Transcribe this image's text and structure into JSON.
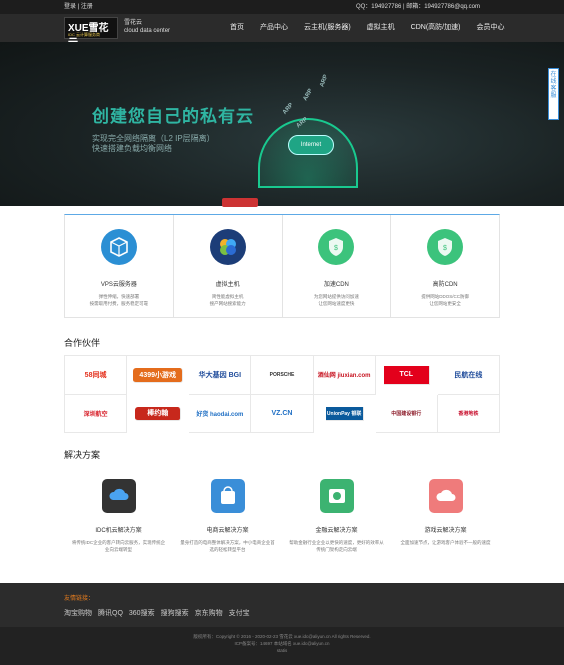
{
  "topbar": {
    "login": "登录",
    "sep": "|",
    "register": "注册",
    "contact": "QQ：194927786 | 邮箱：194927786@qq.com"
  },
  "logo": {
    "main": "XUE雪花云",
    "sub": "IDC 云计算服务商"
  },
  "brand": {
    "cn": "雪花云",
    "en": "cloud data center"
  },
  "nav": [
    "首页",
    "产品中心",
    "云主机(服务器)",
    "虚拟主机",
    "CDN(高防/加速)",
    "会员中心"
  ],
  "hero": {
    "title": "创建您自己的私有云",
    "line1": "实现完全网络隔离（L2 IP层隔离）",
    "line2": "快速搭建负载均衡网络",
    "badge": "Internet",
    "arp": "ARP"
  },
  "float": "在线客服",
  "services": [
    {
      "title": "VPS云服务器",
      "desc1": "弹性伸缩，快速部署",
      "desc2": "按需取用付费，服务稳定可靠"
    },
    {
      "title": "虚拟主机",
      "desc1": "简性能虚拟主机",
      "desc2": "搜产网站搜索能力"
    },
    {
      "title": "加速CDN",
      "desc1": "为您网站提供访问加速",
      "desc2": "让您网站速度更快"
    },
    {
      "title": "高防CDN",
      "desc1": "提供网站DDOS/CC防御",
      "desc2": "让您网站更安全"
    }
  ],
  "partners_title": "合作伙伴",
  "partners": [
    "58同城",
    "4399小游戏",
    "华大基因 BGI",
    "PORSCHE",
    "酒仙网 jiuxian.com",
    "TCL",
    "民航在线",
    "深圳航空",
    "棒约翰",
    "好货 haodai.com",
    "VZ.CN",
    "UnionPay 银联",
    "中国建设银行",
    "香港地铁"
  ],
  "solutions_title": "解决方案",
  "solutions": [
    {
      "title": "IDC机云解决方案",
      "desc": "将传统IDC企业的客户转向云服务，实现传统企业向云端转型"
    },
    {
      "title": "电商云解决方案",
      "desc": "量身打造的电商整体解决方案，中小电商企业首选的轻松转型平台"
    },
    {
      "title": "金融云解决方案",
      "desc": "帮助金融行业企业以更快的速度，更好的效率从传统门架构走向云端"
    },
    {
      "title": "游戏云解决方案",
      "desc": "全面加速节点，让游戏客户体验不一般的速度"
    }
  ],
  "footer": {
    "friend_label": "友情链接：",
    "links": [
      "淘宝购物",
      "腾讯QQ",
      "360搜索",
      "搜狗搜索",
      "京东购物",
      "支付宝"
    ],
    "copyright": "版权所有：Copyright © 2016 - 2020-02-23 雪花云 xue.idc@aliyun.cn All rights Reserved.",
    "icp": "ICP备案号：14697 本站域名 xue.idc@aliyun.cn",
    "stat": "statis"
  },
  "colors": {
    "accent": "#2fb5a2",
    "nav_bg": "#2b2b2b",
    "footer_link": "#e07a1f",
    "blue": "#3a8ed8"
  }
}
